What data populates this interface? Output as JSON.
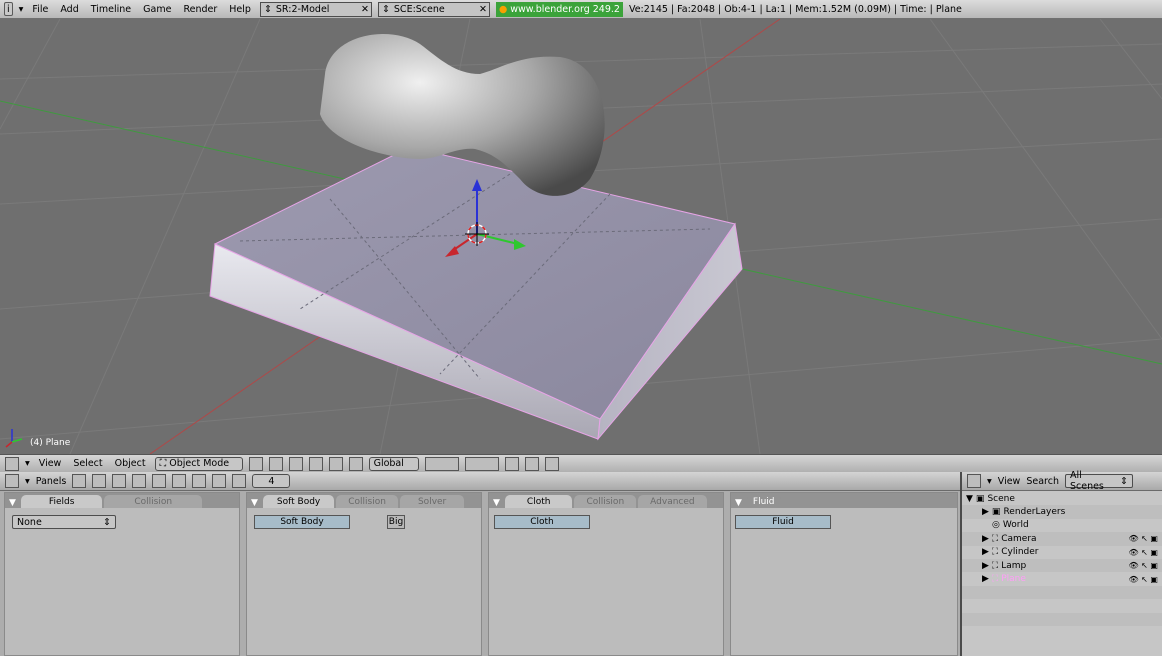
{
  "topbar": {
    "menus": [
      "File",
      "Add",
      "Timeline",
      "Game",
      "Render",
      "Help"
    ],
    "screen": "SR:2-Model",
    "scene": "SCE:Scene",
    "url": "www.blender.org 249.2",
    "stats": "Ve:2145 | Fa:2048 | Ob:4-1 | La:1  | Mem:1.52M (0.09M)  | Time: | Plane"
  },
  "viewport": {
    "label": "(4) Plane"
  },
  "toolbar3d": {
    "menus": [
      "View",
      "Select",
      "Object"
    ],
    "mode": "Object Mode",
    "orientation": "Global"
  },
  "buttons_header": {
    "label": "Panels",
    "frame": "4"
  },
  "panels": [
    {
      "tabs": [
        "Fields",
        "Collision"
      ],
      "select_value": "None"
    },
    {
      "tabs": [
        "Soft Body",
        "Collision",
        "Solver"
      ],
      "button": "Soft Body",
      "toggle": "Big"
    },
    {
      "tabs": [
        "Cloth",
        "Collision",
        "Advanced"
      ],
      "button": "Cloth"
    },
    {
      "tabs": [
        "Fluid"
      ],
      "button": "Fluid"
    }
  ],
  "outliner": {
    "menus": [
      "View",
      "Search"
    ],
    "scene_filter": "All Scenes",
    "items": [
      {
        "label": "Scene"
      },
      {
        "label": "RenderLayers"
      },
      {
        "label": "World"
      },
      {
        "label": "Camera"
      },
      {
        "label": "Cylinder"
      },
      {
        "label": "Lamp"
      },
      {
        "label": "Plane"
      }
    ]
  },
  "colors": {
    "viewport_bg": "#6f6f6f",
    "axis_x": "#c8262d",
    "axis_y": "#2ec82e",
    "axis_z": "#2a32d6",
    "selected": "#ff9ef7",
    "url_bg": "#3ba33a"
  }
}
